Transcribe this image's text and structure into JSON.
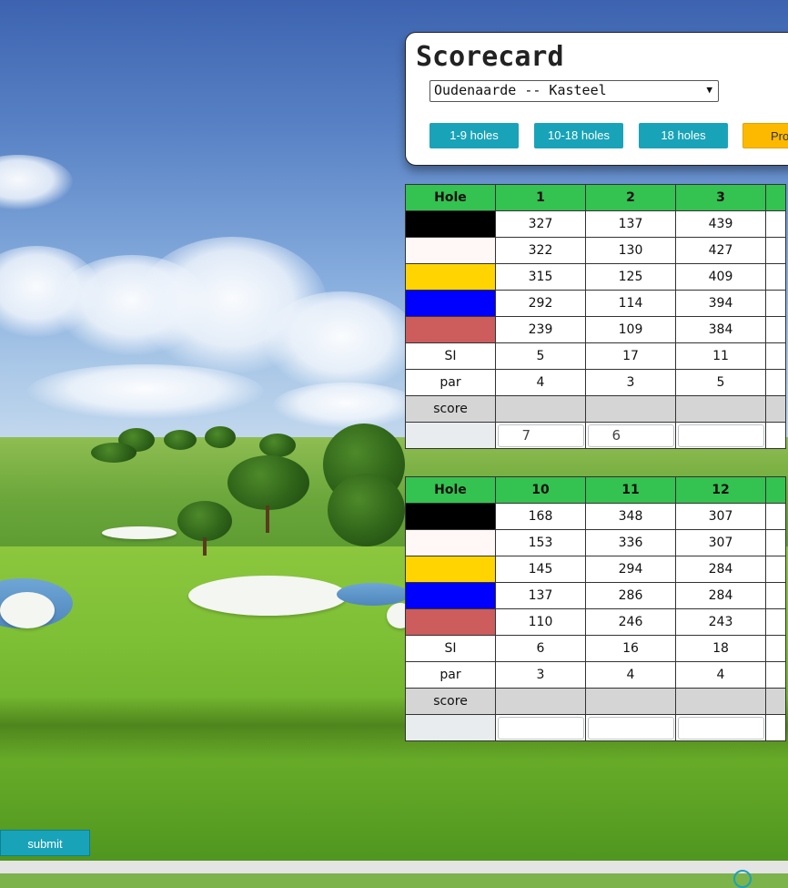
{
  "scorecard": {
    "title": "Scorecard",
    "course_selected": "Oudenaarde -- Kasteel",
    "buttons": {
      "holes_1_9": "1-9 holes",
      "holes_10_18": "10-18 holes",
      "holes_18": "18 holes",
      "pro": "Pro"
    }
  },
  "colors": {
    "header_green": "#34c250",
    "button_teal": "#19a3b8",
    "button_yellow": "#fcb900",
    "tee_black": "#000000",
    "tee_white": "#fff8f6",
    "tee_yellow": "#ffd400",
    "tee_blue": "#0000ff",
    "tee_red": "#cd5c5c"
  },
  "front": {
    "header": [
      "Hole",
      "1",
      "2",
      "3"
    ],
    "tees": [
      [
        "327",
        "137",
        "439"
      ],
      [
        "322",
        "130",
        "427"
      ],
      [
        "315",
        "125",
        "409"
      ],
      [
        "292",
        "114",
        "394"
      ],
      [
        "239",
        "109",
        "384"
      ]
    ],
    "si_label": "SI",
    "si": [
      "5",
      "17",
      "11"
    ],
    "par_label": "par",
    "par": [
      "4",
      "3",
      "5"
    ],
    "score_label": "score",
    "inputs": [
      "7",
      "6",
      ""
    ]
  },
  "back": {
    "header": [
      "Hole",
      "10",
      "11",
      "12"
    ],
    "tees": [
      [
        "168",
        "348",
        "307"
      ],
      [
        "153",
        "336",
        "307"
      ],
      [
        "145",
        "294",
        "284"
      ],
      [
        "137",
        "286",
        "284"
      ],
      [
        "110",
        "246",
        "243"
      ]
    ],
    "si_label": "SI",
    "si": [
      "6",
      "16",
      "18"
    ],
    "par_label": "par",
    "par": [
      "3",
      "4",
      "4"
    ],
    "score_label": "score",
    "inputs": [
      "",
      "",
      ""
    ]
  },
  "submit_label": "submit"
}
